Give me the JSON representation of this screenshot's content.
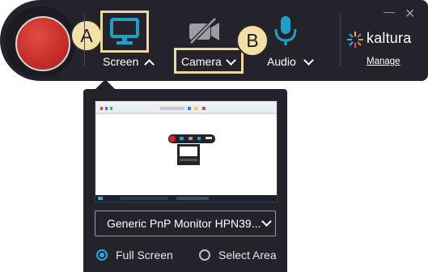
{
  "toolbar": {
    "record_button": "record",
    "screen": {
      "label": "Screen",
      "icon": "monitor-icon",
      "callout": "A",
      "active_color": "#1ea0c9"
    },
    "camera": {
      "label": "Camera",
      "icon": "camera-off-icon",
      "callout": "B"
    },
    "audio": {
      "label": "Audio",
      "icon": "microphone-icon",
      "color": "#1ea0c9"
    },
    "brand": {
      "name": "kaltura",
      "logo_icon": "kaltura-sun-icon"
    },
    "manage_label": "Manage",
    "window_controls": {
      "minimize": "—",
      "close": "✕"
    }
  },
  "screen_panel": {
    "monitor_select": {
      "value": "Generic PnP Monitor HPN39..."
    },
    "options": [
      {
        "label": "Full Screen",
        "selected": true
      },
      {
        "label": "Select Area",
        "selected": false
      }
    ]
  },
  "colors": {
    "background": "#24232b",
    "record": "#c42d28",
    "accent": "#29a9e1",
    "highlight": "#eed89a",
    "badge": "#f2e0a6"
  }
}
